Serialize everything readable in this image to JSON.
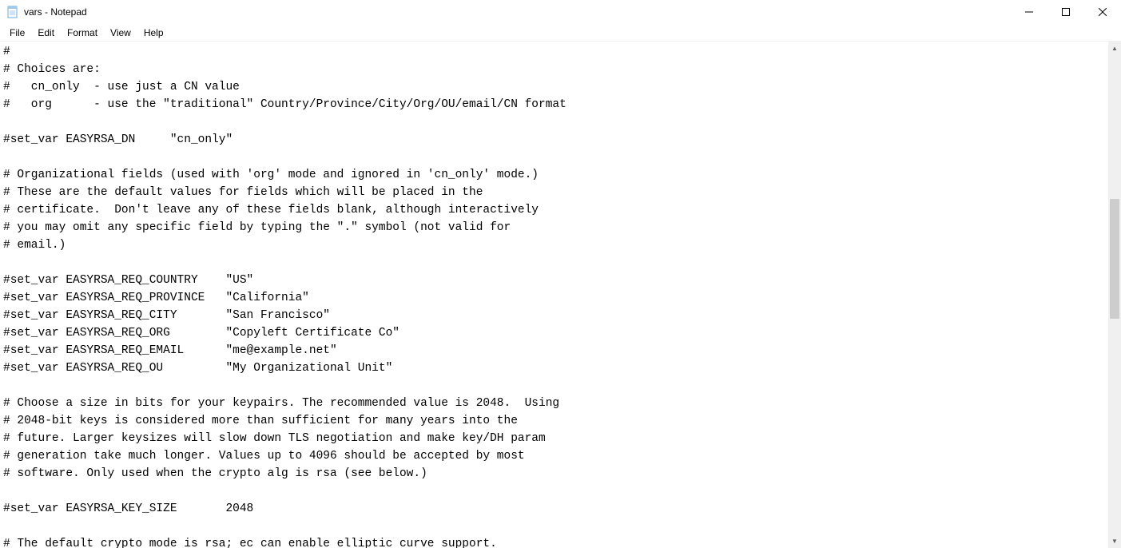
{
  "window": {
    "title": "vars - Notepad"
  },
  "menu": {
    "file": "File",
    "edit": "Edit",
    "format": "Format",
    "view": "View",
    "help": "Help"
  },
  "editor": {
    "content": "#\n# Choices are:\n#   cn_only  - use just a CN value\n#   org      - use the \"traditional\" Country/Province/City/Org/OU/email/CN format\n\n#set_var EASYRSA_DN     \"cn_only\"\n\n# Organizational fields (used with 'org' mode and ignored in 'cn_only' mode.)\n# These are the default values for fields which will be placed in the\n# certificate.  Don't leave any of these fields blank, although interactively\n# you may omit any specific field by typing the \".\" symbol (not valid for\n# email.)\n\n#set_var EASYRSA_REQ_COUNTRY    \"US\"\n#set_var EASYRSA_REQ_PROVINCE   \"California\"\n#set_var EASYRSA_REQ_CITY       \"San Francisco\"\n#set_var EASYRSA_REQ_ORG        \"Copyleft Certificate Co\"\n#set_var EASYRSA_REQ_EMAIL      \"me@example.net\"\n#set_var EASYRSA_REQ_OU         \"My Organizational Unit\"\n\n# Choose a size in bits for your keypairs. The recommended value is 2048.  Using\n# 2048-bit keys is considered more than sufficient for many years into the\n# future. Larger keysizes will slow down TLS negotiation and make key/DH param\n# generation take much longer. Values up to 4096 should be accepted by most\n# software. Only used when the crypto alg is rsa (see below.)\n\n#set_var EASYRSA_KEY_SIZE       2048\n\n# The default crypto mode is rsa; ec can enable elliptic curve support."
  }
}
